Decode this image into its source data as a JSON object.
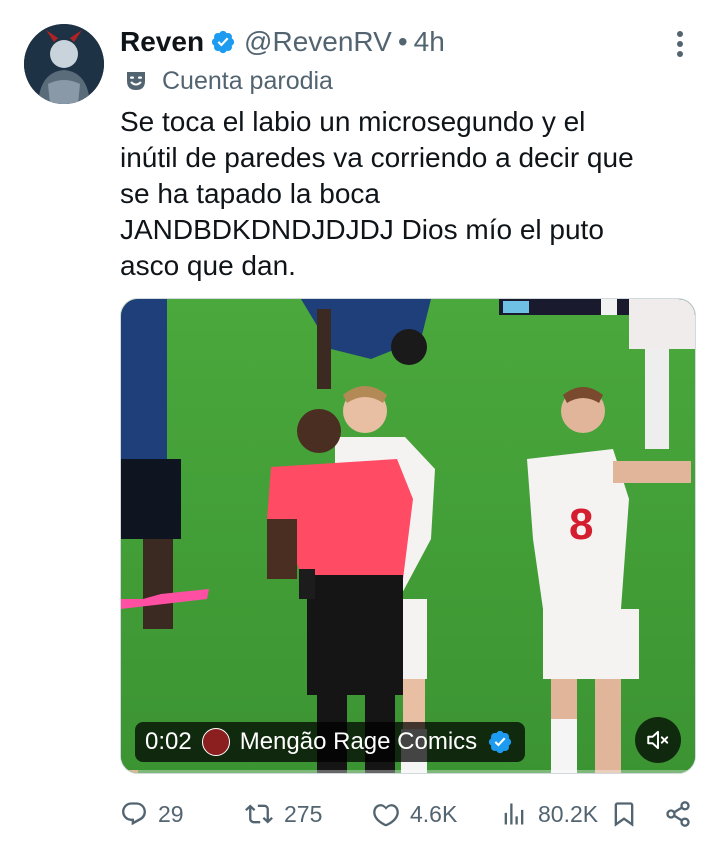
{
  "tweet": {
    "author": {
      "display_name": "Reven",
      "handle": "@RevenRV",
      "separator": "•",
      "time": "4h",
      "verified": true
    },
    "account_label": "Cuenta parodia",
    "text": "Se toca el labio un microsegundo y el\ninútil de paredes va corriendo a decir que\nse ha tapado la boca\nJANDBDKDNDJDJDJ Dios mío el puto\nasco que dan.",
    "media": {
      "type": "video",
      "elapsed": "0:02",
      "source_name": "Mengão Rage Comics",
      "source_verified": true,
      "progress": 0.03,
      "muted": true
    },
    "actions": {
      "replies": "29",
      "retweets": "275",
      "likes": "4.6K",
      "views": "80.2K"
    }
  },
  "colors": {
    "text_primary": "#0f1419",
    "text_secondary": "#536471",
    "verified_blue": "#1d9bf0",
    "pitch_green": "#3d9a33",
    "referee_shirt": "#ff4b63"
  },
  "icons": [
    "verified-icon",
    "more-icon",
    "parody-mask-icon",
    "mute-icon",
    "reply-icon",
    "retweet-icon",
    "like-icon",
    "views-icon",
    "bookmark-icon",
    "share-icon"
  ]
}
